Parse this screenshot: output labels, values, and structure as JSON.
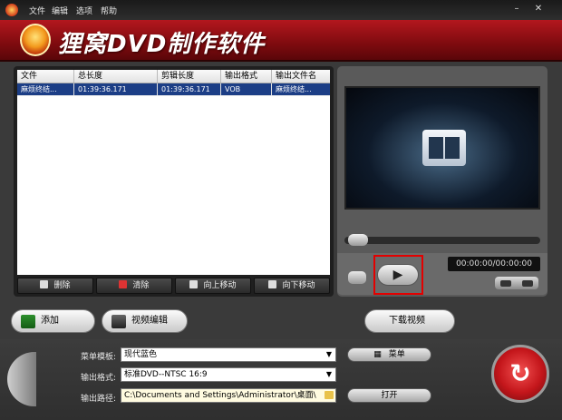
{
  "menu": [
    "文件",
    "编辑",
    "选项",
    "帮助"
  ],
  "app_title": "狸窝DVD制作软件",
  "table": {
    "headers": [
      "文件",
      "总长度",
      "剪辑长度",
      "输出格式",
      "输出文件名"
    ],
    "rows": [
      [
        "麻烦终结...",
        "01:39:36.171",
        "01:39:36.171",
        "VOB",
        "麻烦终结..."
      ]
    ]
  },
  "table_buttons": [
    "删除",
    "清除",
    "向上移动",
    "向下移动"
  ],
  "player": {
    "time": "00:00:00/00:00:00",
    "seek_fraction": 0
  },
  "actions": {
    "add": "添加",
    "video_edit": "视频编辑",
    "download": "下载视频"
  },
  "settings": {
    "menu_template_label": "菜单模板:",
    "menu_template_value": "现代蓝色",
    "output_format_label": "输出格式:",
    "output_format_value": "标准DVD--NTSC 16:9",
    "output_path_label": "输出路径:",
    "output_path_value": "C:\\Documents and Settings\\Administrator\\桌面\\",
    "menu_button": "菜单",
    "open_button": "打开"
  },
  "colors": {
    "banner": "#8e0e12",
    "selection": "#1c3e86",
    "highlight_box": "#e30000"
  }
}
